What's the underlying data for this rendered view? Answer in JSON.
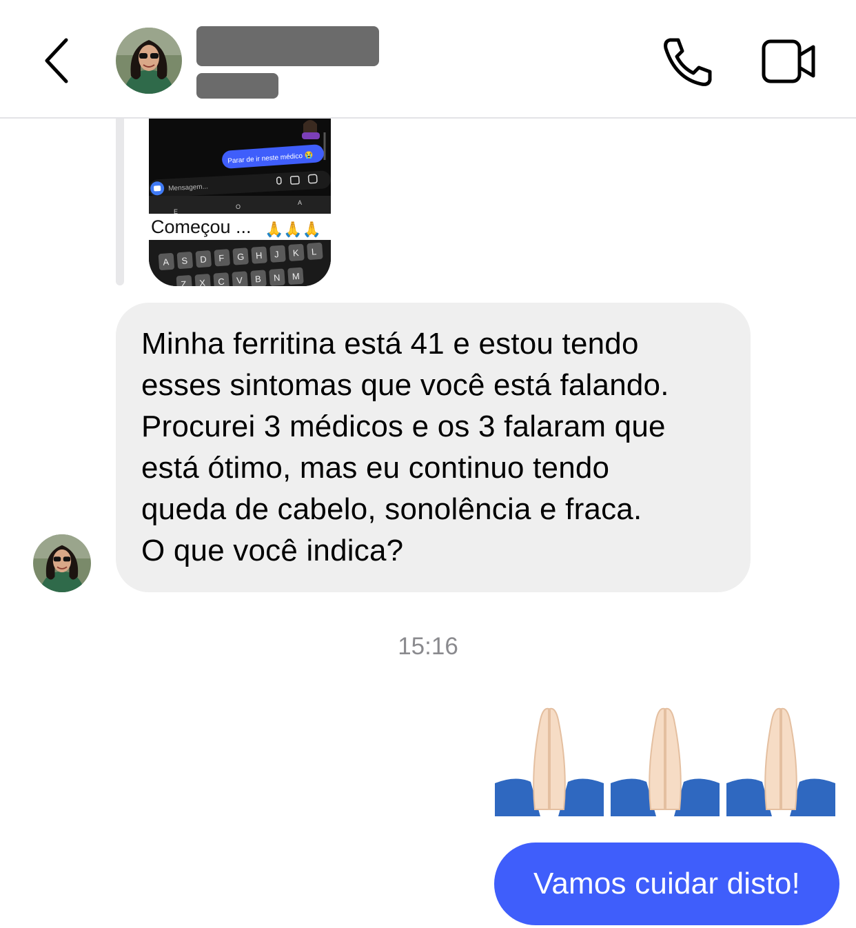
{
  "header": {
    "contact_name": "",
    "contact_status": "",
    "back_icon": "chevron-left-icon",
    "call_icon": "phone-icon",
    "video_icon": "video-camera-icon"
  },
  "story_reply": {
    "chat_bubble_text": "Parar de ir neste médico 😭",
    "composer_placeholder": "Mensagem...",
    "caption": "Começou ...",
    "caption_emoji": "🙏🙏🙏",
    "suggestion_keys": [
      "E",
      "O",
      "A"
    ],
    "keyboard_row_2": [
      "A",
      "S",
      "D",
      "F",
      "G",
      "H",
      "J",
      "K",
      "L"
    ],
    "keyboard_row_3": [
      "Z",
      "X",
      "C",
      "V",
      "B",
      "N",
      "M"
    ]
  },
  "messages": {
    "incoming": {
      "lines": [
        "Minha ferritina está 41 e estou tendo",
        "esses sintomas que você está falando.",
        "Procurei 3 médicos e os 3 falaram que",
        "está ótimo, mas eu continuo tendo",
        "queda de cabelo, sonolência e fraca.",
        "O que você indica?"
      ]
    },
    "timestamp": "15:16",
    "outgoing_emoji": "🙏🙏🙏",
    "outgoing_text": "Vamos cuidar disto!"
  },
  "colors": {
    "outgoing_bubble": "#3f5efb",
    "incoming_bubble": "#efefef",
    "redaction": "#6b6b6b",
    "timestamp": "#8a8a8e"
  }
}
